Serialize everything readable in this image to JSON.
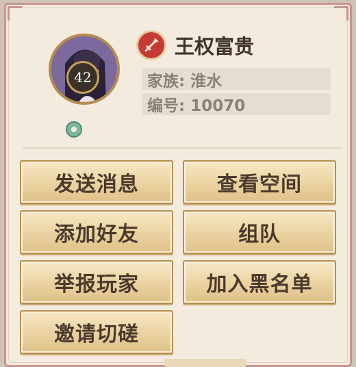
{
  "player": {
    "level": "42",
    "name": "王权富贵",
    "family": "家族: 淮水",
    "id_line": "编号: 10070",
    "badge_icon": "sword-icon"
  },
  "actions": {
    "send_message": "发送消息",
    "view_space": "查看空间",
    "add_friend": "添加好友",
    "team_up": "组队",
    "report_player": "举报玩家",
    "blacklist": "加入黑名单",
    "invite_duel": "邀请切磋"
  },
  "colors": {
    "panel_bg": "#f3ebde",
    "panel_border": "#c9948f",
    "badge_red": "#c43b35",
    "button_text": "#4a3a2c"
  }
}
